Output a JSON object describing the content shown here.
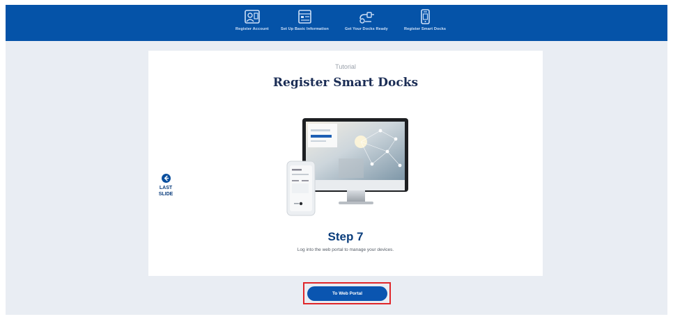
{
  "header": {
    "steps": [
      {
        "label": "Register Account",
        "icon": "account-register-icon"
      },
      {
        "label": "Set Up Basic Information",
        "icon": "basic-info-form-icon"
      },
      {
        "label": "Get Your Docks Ready",
        "icon": "docks-ready-icon"
      },
      {
        "label": "Register Smart Docks",
        "icon": "smart-dock-phone-icon"
      }
    ]
  },
  "tutorial": {
    "subtitle": "Tutorial",
    "title": "Register Smart Docks",
    "step_title": "Step 7",
    "step_description": "Log into the web portal to manage your devices."
  },
  "navigation": {
    "back_label_line1": "LAST",
    "back_label_line2": "SLIDE",
    "back_icon": "arrow-left-circle-icon"
  },
  "cta": {
    "label": "To Web Portal"
  },
  "colors": {
    "brand_blue": "#0553a8",
    "title_navy": "#1b2d55",
    "highlight_red": "#e0262a",
    "page_background": "#e9edf3"
  }
}
